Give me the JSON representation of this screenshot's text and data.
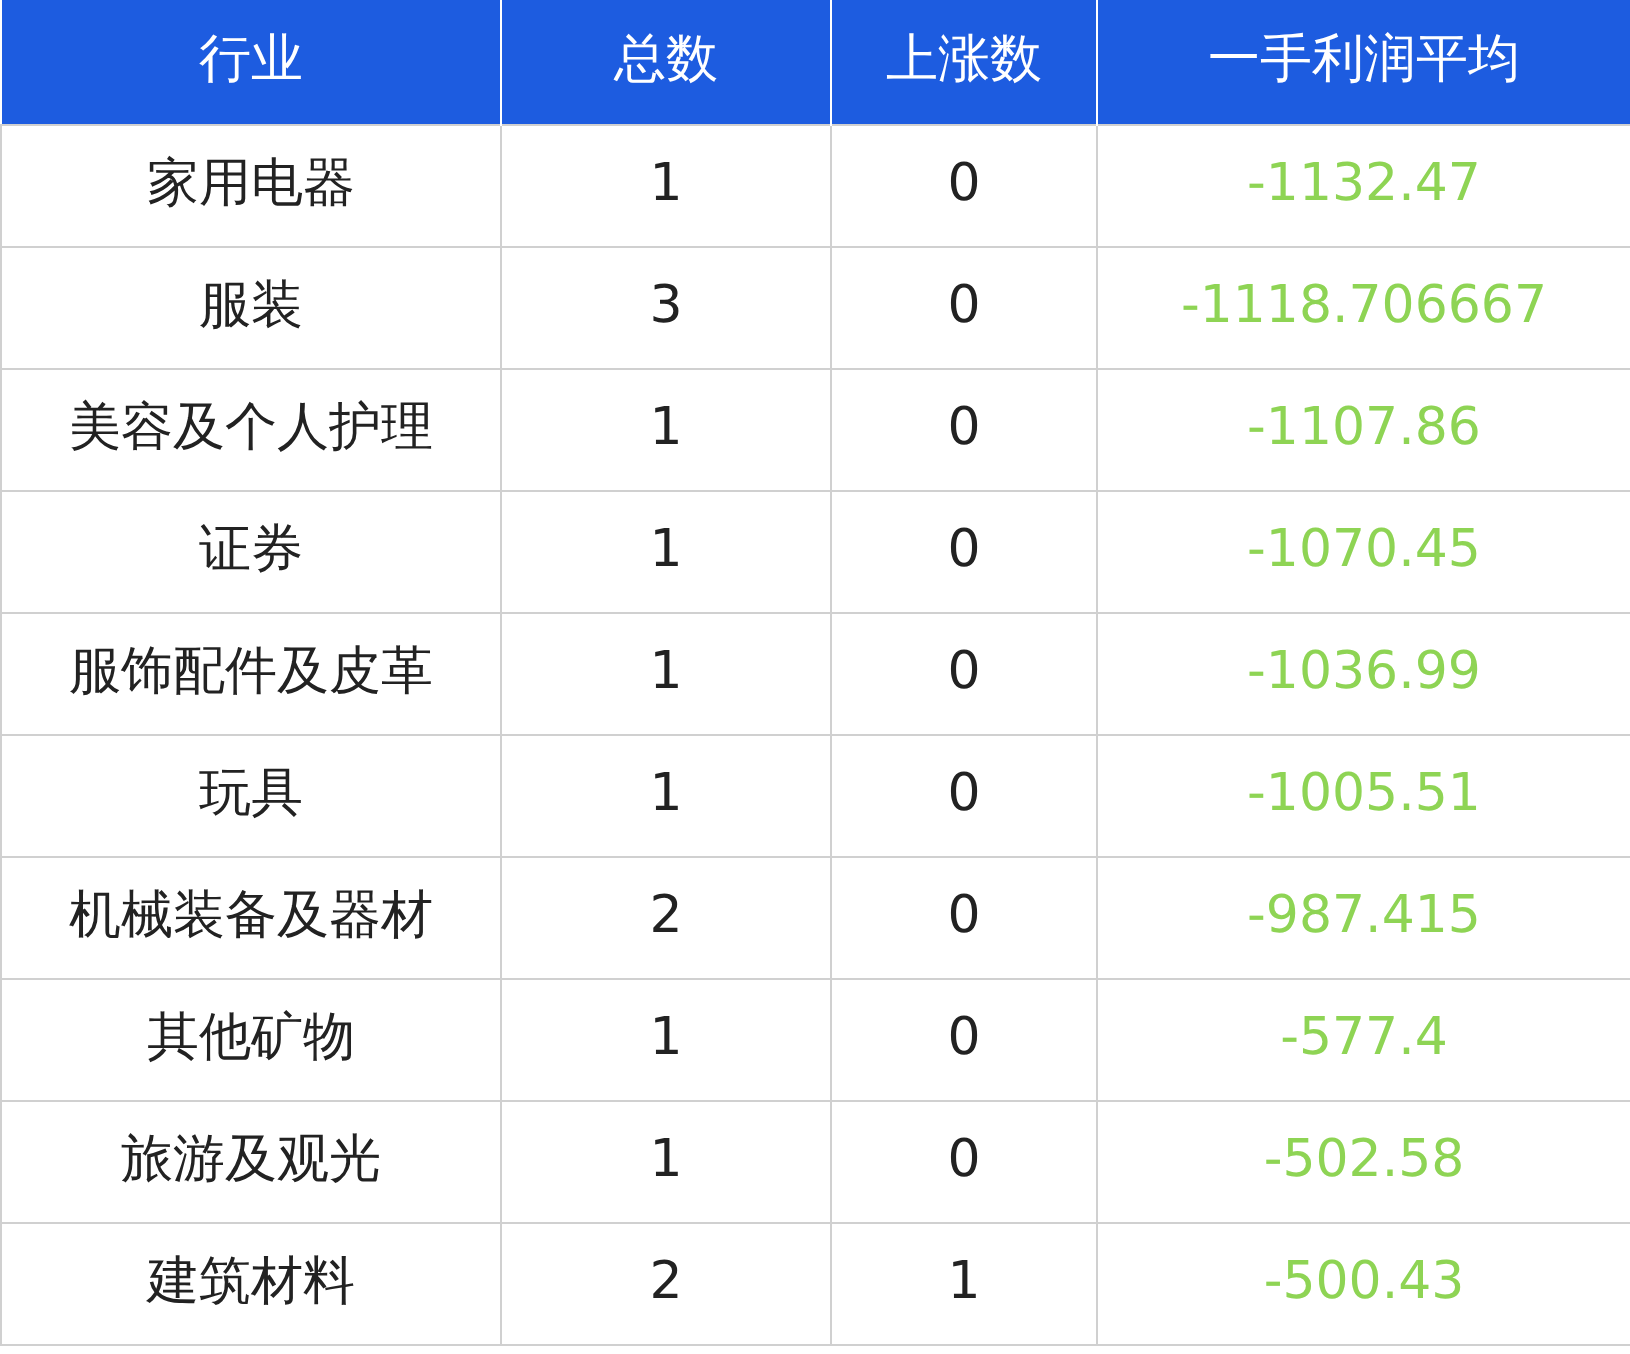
{
  "table": {
    "columns": [
      "行业",
      "总数",
      "上涨数",
      "一手利润平均"
    ],
    "rows": [
      [
        "家用电器",
        "1",
        "0",
        "-1132.47"
      ],
      [
        "服装",
        "3",
        "0",
        "-1118.706667"
      ],
      [
        "美容及个人护理",
        "1",
        "0",
        "-1107.86"
      ],
      [
        "证券",
        "1",
        "0",
        "-1070.45"
      ],
      [
        "服饰配件及皮革",
        "1",
        "0",
        "-1036.99"
      ],
      [
        "玩具",
        "1",
        "0",
        "-1005.51"
      ],
      [
        "机械装备及器材",
        "2",
        "0",
        "-987.415"
      ],
      [
        "其他矿物",
        "1",
        "0",
        "-577.4"
      ],
      [
        "旅游及观光",
        "1",
        "0",
        "-502.58"
      ],
      [
        "建筑材料",
        "2",
        "1",
        "-500.43"
      ]
    ]
  }
}
